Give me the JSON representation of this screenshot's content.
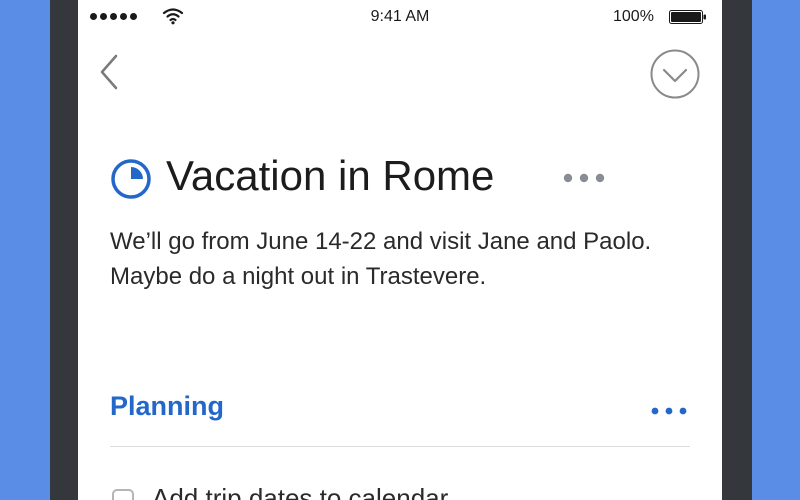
{
  "status_bar": {
    "time": "9:41 AM",
    "battery_percent": "100%",
    "signal_bars": 5,
    "icons": [
      "signal-icon",
      "wifi-icon",
      "battery-icon"
    ]
  },
  "nav": {
    "back_icon": "chevron-left-icon",
    "complete_icon": "checkmark-circle-icon"
  },
  "project": {
    "title": "Vacation in Rome",
    "progress_icon": "pie-progress-icon",
    "more_icon": "ellipsis-icon",
    "notes": "We’ll go from June 14-22 and visit Jane and Paolo. Maybe do a night out in Trastevere."
  },
  "section": {
    "heading": "Planning",
    "more_icon": "ellipsis-icon",
    "items": [
      {
        "label": "Add trip dates to calendar",
        "checked": false
      }
    ]
  },
  "colors": {
    "accent": "#2367c9",
    "background": "#5a8ee6",
    "device_frame": "#34373c"
  }
}
